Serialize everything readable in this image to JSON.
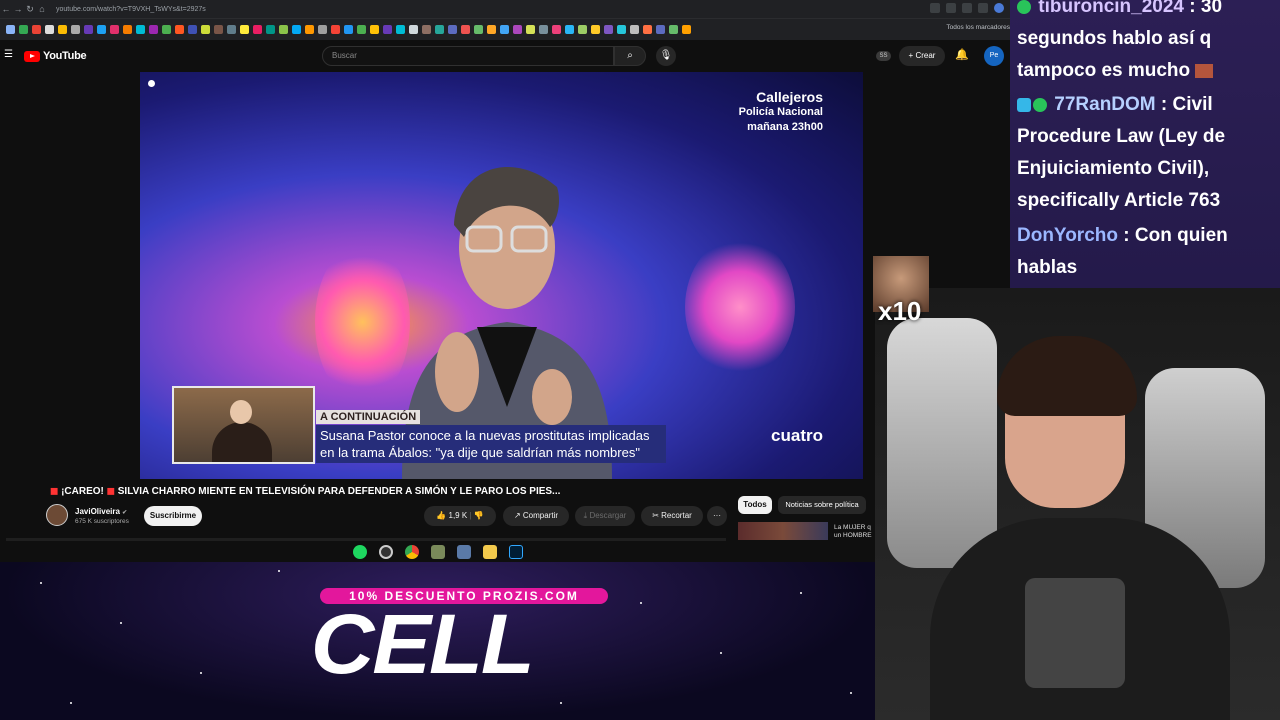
{
  "browser": {
    "url": "youtube.com/watch?v=T9VXH_TsWYs&t=2927s",
    "bookmarks_all": "Todos los marcadores"
  },
  "youtube": {
    "logo_text": "YouTube",
    "search_placeholder": "Buscar",
    "ss_badge": "SS",
    "create_label": "Crear",
    "menu_icon": "☰",
    "search_icon": "⌕",
    "mic_icon": "🎙",
    "bell_icon": "🔔",
    "avatar_text": "Pe"
  },
  "video": {
    "channel_logo_line1": "Callejeros",
    "channel_logo_line2": "Policía Nacional",
    "channel_logo_line3": "mañana 23h00",
    "network": "cuatro",
    "lower_third_tag": "A CONTINUACIÓN",
    "lower_third_line1": "Susana Pastor conoce a la nuevas prostitutas implicadas",
    "lower_third_line2": "en la trama Ábalos: \"ya dije que saldrían  más nombres\""
  },
  "watch": {
    "title_prefix": "¡CAREO!",
    "title_main": "SILVIA CHARRO MIENTE EN TELEVISIÓN PARA DEFENDER A SIMÓN Y LE PARO LOS PIES...",
    "channel_name": "JaviOliveira",
    "verified": "✔",
    "subscribers": "675 K suscriptores",
    "subscribe_label": "Suscribirme",
    "like_count": "1,9 K",
    "share_label": "Compartir",
    "download_label": "Descargar",
    "clip_label": "Recortar",
    "more_label": "···",
    "chip_all": "Todos",
    "chip_news": "Noticias sobre política",
    "side_video_title_1": "La MUJER q",
    "side_video_title_2": "un HOMBRE"
  },
  "overlay": {
    "promo": "10% DESCUENTO PROZIS.COM",
    "brand": "CELL",
    "emote_multiplier": "x10"
  },
  "chat": {
    "messages": [
      {
        "user": "tiburoncin_2024",
        "text": "30 segundos hablo así q tampoco es mucho"
      },
      {
        "user": "77RanDOM",
        "text": "Civil Procedure Law (Ley de Enjuiciamiento Civil), specifically Article 763"
      },
      {
        "user": "DonYorcho",
        "text": "Con quien hablas"
      }
    ]
  },
  "colors": {
    "youtube_red": "#ff0000",
    "promo_pink": "#e3179c",
    "chat_bg": "#2c1f55"
  }
}
